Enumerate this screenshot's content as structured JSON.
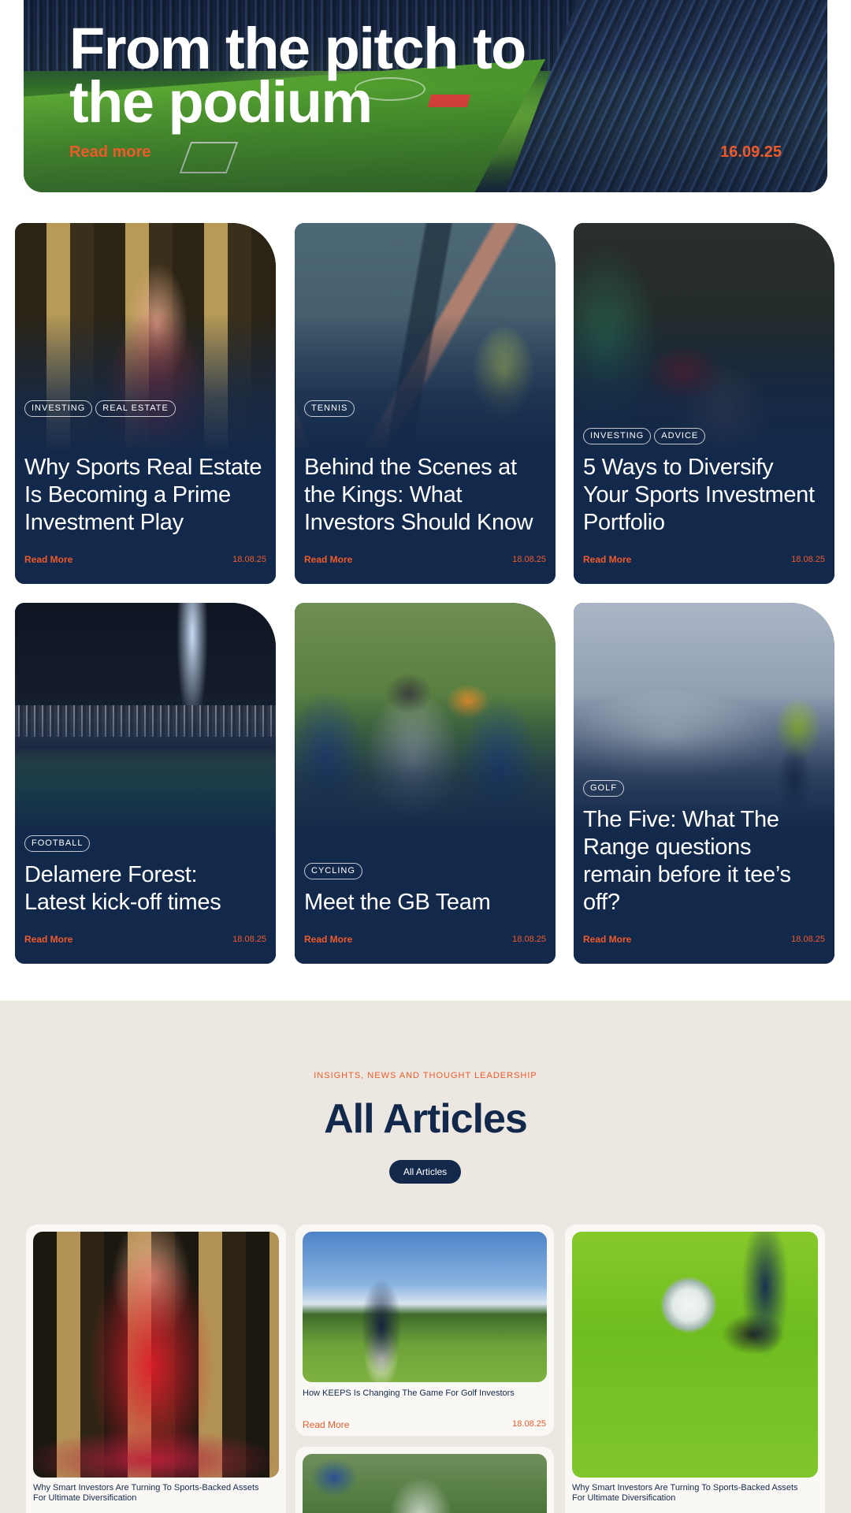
{
  "hero": {
    "title": "From the pitch to the podium",
    "read_more": "Read more",
    "date": "16.09.25"
  },
  "featured": [
    {
      "tags": [
        "INVESTING",
        "REAL ESTATE"
      ],
      "title": "Why Sports Real Estate Is Becoming a Prime Investment Play",
      "read_more": "Read More",
      "date": "18.08.25"
    },
    {
      "tags": [
        "TENNIS"
      ],
      "title": "Behind the Scenes at the Kings: What Investors Should Know",
      "read_more": "Read More",
      "date": "18.08.25"
    },
    {
      "tags": [
        "INVESTING",
        "ADVICE"
      ],
      "title": "5 Ways to Diversify Your Sports Investment Portfolio",
      "read_more": "Read More",
      "date": "18.08.25"
    },
    {
      "tags": [
        "FOOTBALL"
      ],
      "title": "Delamere Forest: Latest kick-off times",
      "read_more": "Read More",
      "date": "18.08.25"
    },
    {
      "tags": [
        "CYCLING"
      ],
      "title": "Meet the GB Team",
      "read_more": "Read More",
      "date": "18.08.25"
    },
    {
      "tags": [
        "GOLF"
      ],
      "title": "The Five: What The Range questions remain before it tee’s off?",
      "read_more": "Read More",
      "date": "18.08.25"
    }
  ],
  "articles": {
    "eyebrow": "INSIGHTS, NEWS AND THOUGHT LEADERSHIP",
    "title": "All Articles",
    "filter_label": "All Articles",
    "items": [
      {
        "caption": "Why Smart Investors Are Turning To Sports-Backed Assets For Ultimate Diversification"
      },
      {
        "caption": "How KEEPS Is Changing The Game For Golf Investors",
        "read_more": "Read More",
        "date": "18.08.25"
      },
      {
        "caption": "Why Smart Investors Are Turning To Sports-Backed Assets For Ultimate Diversification"
      }
    ]
  },
  "colors": {
    "navy": "#13294b",
    "accent": "#ef5a2b",
    "beige": "#ece8e1"
  }
}
